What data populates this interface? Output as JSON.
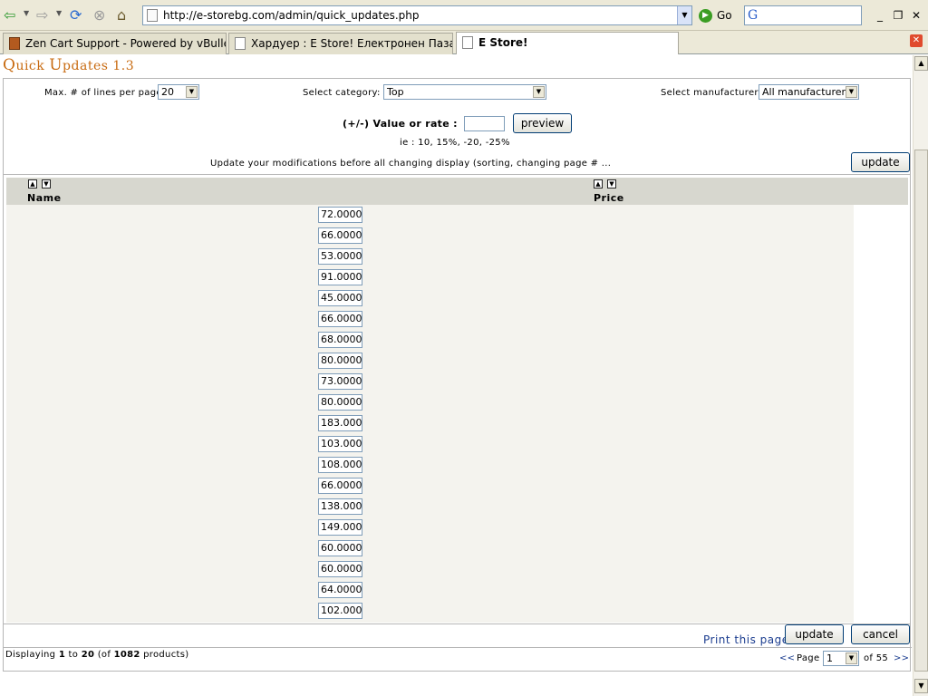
{
  "browser": {
    "url": "http://e-storebg.com/admin/quick_updates.php",
    "go_label": "Go",
    "tabs": [
      {
        "title": "Zen Cart Support - Powered by vBulletin"
      },
      {
        "title": "Хардуер : E Store! Електронен Пазар"
      },
      {
        "title": "E Store!"
      }
    ]
  },
  "page": {
    "title_Q": "Q",
    "title_rest": "uick ",
    "title_U": "U",
    "title_rest2": "pdates 1.3"
  },
  "filters": {
    "max_lines_label": "Max. # of lines per page",
    "max_lines_value": "20",
    "category_label": "Select category:",
    "category_value": "Top",
    "manufacturer_label": "Select manufacturer",
    "manufacturer_value": "All manufacturers",
    "rate_label": "(+/-) Value or rate :",
    "rate_value": "",
    "preview_label": "preview",
    "rate_hint": "ie : 10, 15%, -20, -25%",
    "update_note": "Update your modifications before all changing display (sorting, changing page # ...",
    "update_label": "update"
  },
  "table": {
    "col_name": "Name",
    "col_price": "Price",
    "prices": [
      "72.0000",
      "66.0000",
      "53.0000",
      "91.0000",
      "45.0000",
      "66.0000",
      "68.0000",
      "80.0000",
      "73.0000",
      "80.0000",
      "183.0000",
      "103.0000",
      "108.0000",
      "66.0000",
      "138.0000",
      "149.0000",
      "60.0000",
      "60.0000",
      "64.0000",
      "102.0000"
    ]
  },
  "footer": {
    "print_label": "Print this page",
    "update_label": "update",
    "cancel_label": "cancel",
    "displaying": "Displaying ",
    "from": "1",
    "to_word": " to ",
    "to": "20",
    "of_word": " (of ",
    "total": "1082",
    "products_word": " products)",
    "prev": "<<",
    "page_word": "Page",
    "page_value": "1",
    "of_pages": "of 55",
    "next": ">>"
  }
}
